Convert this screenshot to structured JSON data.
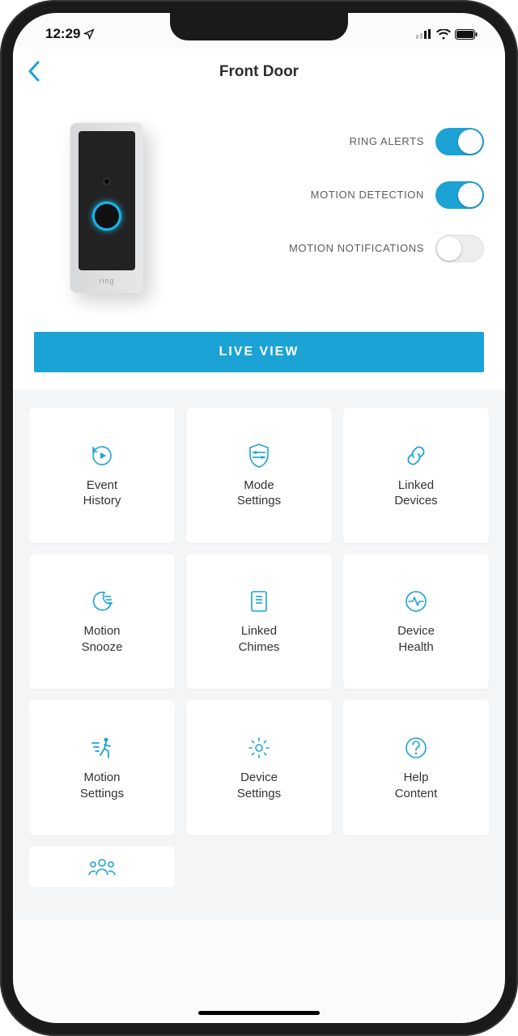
{
  "status": {
    "time": "12:29",
    "location_icon": "location-arrow"
  },
  "header": {
    "title": "Front Door"
  },
  "toggles": {
    "ring_alerts": {
      "label": "RING\nALERTS",
      "on": true
    },
    "motion_detection": {
      "label": "MOTION\nDETECTION",
      "on": true
    },
    "motion_notifications": {
      "label": "MOTION\nNOTIFICATIONS",
      "on": false
    }
  },
  "live_view_label": "LIVE VIEW",
  "tiles": [
    {
      "icon": "history",
      "label": "Event\nHistory"
    },
    {
      "icon": "shield",
      "label": "Mode\nSettings"
    },
    {
      "icon": "link",
      "label": "Linked\nDevices"
    },
    {
      "icon": "moon",
      "label": "Motion\nSnooze"
    },
    {
      "icon": "chime",
      "label": "Linked\nChimes"
    },
    {
      "icon": "health",
      "label": "Device\nHealth"
    },
    {
      "icon": "motion",
      "label": "Motion\nSettings"
    },
    {
      "icon": "gear",
      "label": "Device\nSettings"
    },
    {
      "icon": "help",
      "label": "Help\nContent"
    }
  ],
  "partial_tile_icon": "people",
  "device_brand": "ring",
  "colors": {
    "accent": "#1ca3d6"
  }
}
